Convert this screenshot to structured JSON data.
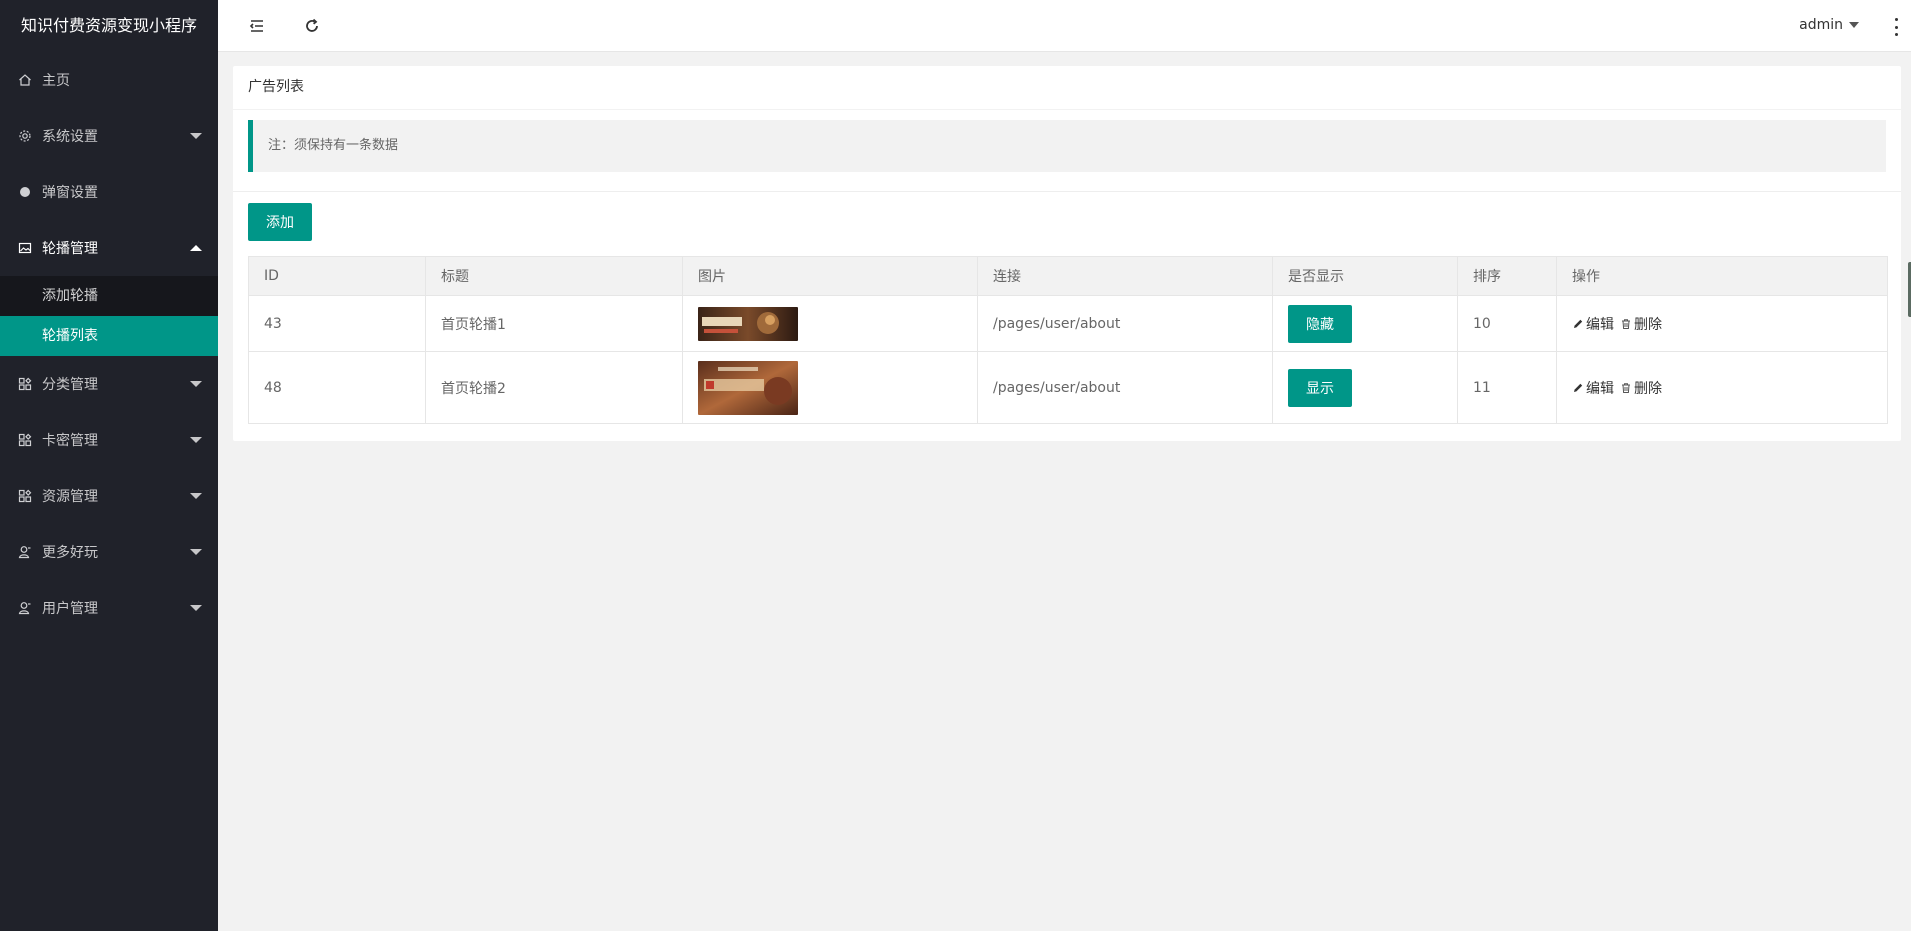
{
  "app": {
    "title": "知识付费资源变现小程序"
  },
  "sidebar": {
    "items": [
      {
        "label": "主页",
        "icon": "home-icon"
      },
      {
        "label": "系统设置",
        "icon": "gear-icon"
      },
      {
        "label": "弹窗设置",
        "icon": "circle-icon"
      },
      {
        "label": "轮播管理",
        "icon": "image-icon",
        "expanded": true,
        "children": [
          {
            "label": "添加轮播"
          },
          {
            "label": "轮播列表",
            "active": true
          }
        ]
      },
      {
        "label": "分类管理",
        "icon": "app-grid-icon"
      },
      {
        "label": "卡密管理",
        "icon": "app-grid-icon"
      },
      {
        "label": "资源管理",
        "icon": "app-grid-icon"
      },
      {
        "label": "更多好玩",
        "icon": "user-icon"
      },
      {
        "label": "用户管理",
        "icon": "user-icon"
      }
    ]
  },
  "header": {
    "user": "admin"
  },
  "page": {
    "card_title": "广告列表",
    "notice": "注：须保持有一条数据",
    "add_label": "添加"
  },
  "table": {
    "columns": [
      "ID",
      "标题",
      "图片",
      "连接",
      "是否显示",
      "排序",
      "操作"
    ],
    "rows": [
      {
        "id": "43",
        "title": "首页轮播1",
        "link": "/pages/user/about",
        "status": "隐藏",
        "sort": "10",
        "edit": "编辑",
        "delete": "删除"
      },
      {
        "id": "48",
        "title": "首页轮播2",
        "link": "/pages/user/about",
        "status": "显示",
        "sort": "11",
        "edit": "编辑",
        "delete": "删除"
      }
    ]
  },
  "colors": {
    "accent": "#009688",
    "sidebar_bg": "#20222a",
    "submenu_bg": "#16171c"
  }
}
